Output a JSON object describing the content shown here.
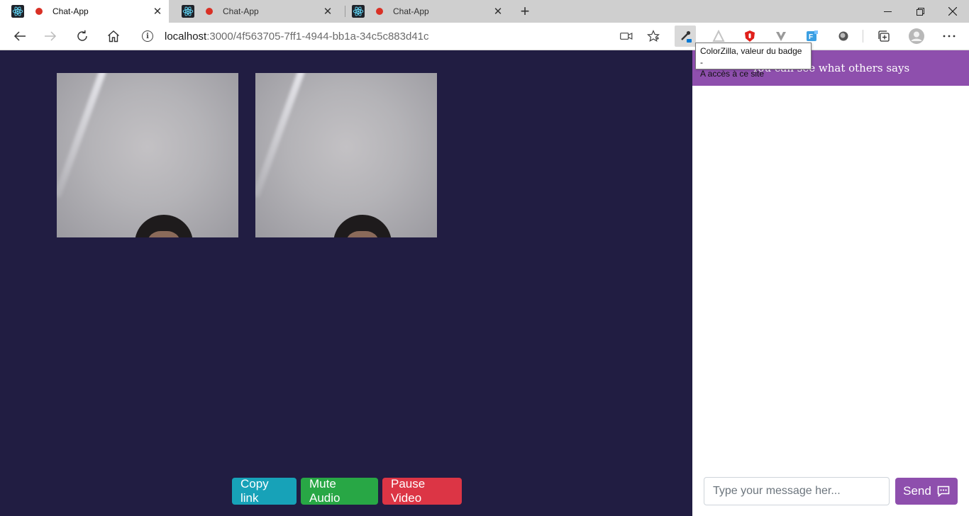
{
  "browser": {
    "tabs": [
      {
        "title": "Chat-App",
        "active": true
      },
      {
        "title": "Chat-App",
        "active": false
      },
      {
        "title": "Chat-App",
        "active": false
      }
    ],
    "address": {
      "host": "localhost",
      "path": ":3000/4f563705-7ff1-4944-bb1a-34c5c883d41c"
    },
    "tooltip": {
      "line1": "ColorZilla, valeur du badge -",
      "line2": "A accès à ce site"
    }
  },
  "controls": {
    "copy_label": "Copy link",
    "mute_label": "Mute Audio",
    "pause_label": "Pause Video"
  },
  "chat": {
    "header": "You can see what others says",
    "input_placeholder": "Type your message her...",
    "send_label": "Send"
  },
  "colors": {
    "page_bg": "#211d42",
    "chat_accent": "#8e4fad",
    "copy": "#17a2b8",
    "mute": "#28a745",
    "pause": "#dc3545"
  }
}
